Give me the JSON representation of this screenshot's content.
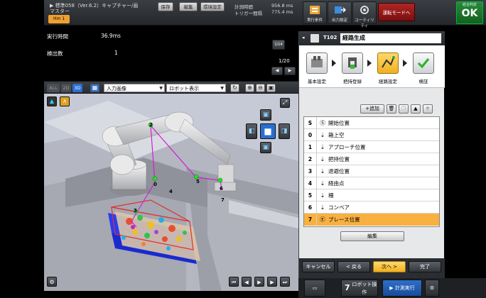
{
  "header": {
    "app_title": "▶ 標準058（Ver.6.2）キャプチャー/画",
    "sub_title": "マスター",
    "scene_tab": "Hm 1",
    "save_btn": "保存",
    "edit_menu": "編集",
    "env_menu": "環境設定",
    "measure_time_label": "計測時間",
    "measure_time_value": "956.8 ms",
    "trigger_label": "トリガー間隔",
    "trigger_value": "775.4 ms",
    "ribbon": [
      {
        "label": "実行条件",
        "icon": "run-condition-icon"
      },
      {
        "label": "出力設定",
        "icon": "output-settings-icon"
      },
      {
        "label": "ユーティリティ",
        "icon": "utility-icon"
      }
    ],
    "run_mode": "運転モードへ",
    "result": "OK",
    "result_caption": "総合判定"
  },
  "info": {
    "exec_time_label": "実行時間",
    "exec_time_value": "36.9ms",
    "count_label": "検出数",
    "count_value": "1",
    "page": "1/20",
    "zoom_label": "1/14"
  },
  "view_toolbar": {
    "modes": [
      "ALL",
      "2D",
      "3D"
    ],
    "image_select": "入力画像",
    "robot_select": "ロボット表示"
  },
  "path_labels": [
    "2",
    "0",
    "4",
    "3",
    "5",
    "6",
    "7"
  ],
  "panel": {
    "step_id": "T102",
    "title": "経路生成",
    "steps": [
      "基本設定",
      "把持登録",
      "経路設定",
      "検証"
    ],
    "add_btn": "追加",
    "rows": [
      {
        "idx": "S",
        "icon": "start-icon",
        "text": "開始位置"
      },
      {
        "idx": "0",
        "icon": "waypoint-icon",
        "text": "箱上空"
      },
      {
        "idx": "1",
        "icon": "waypoint-icon",
        "text": "アプローチ位置"
      },
      {
        "idx": "2",
        "icon": "waypoint-icon",
        "text": "把持位置"
      },
      {
        "idx": "3",
        "icon": "waypoint-icon",
        "text": "退避位置"
      },
      {
        "idx": "4",
        "icon": "waypoint-icon",
        "text": "経由点"
      },
      {
        "idx": "5",
        "icon": "waypoint-icon",
        "text": "柵"
      },
      {
        "idx": "6",
        "icon": "waypoint-icon",
        "text": "コンベア"
      },
      {
        "idx": "7",
        "icon": "end-icon",
        "text": "プレース位置"
      }
    ],
    "edit_btn": "編集",
    "cancel": "キャンセル",
    "back": "< 戻る",
    "next": "次へ >",
    "finish": "完了"
  },
  "bottom": {
    "robot_op": "ロボット操作",
    "measure_run": "計測実行"
  }
}
